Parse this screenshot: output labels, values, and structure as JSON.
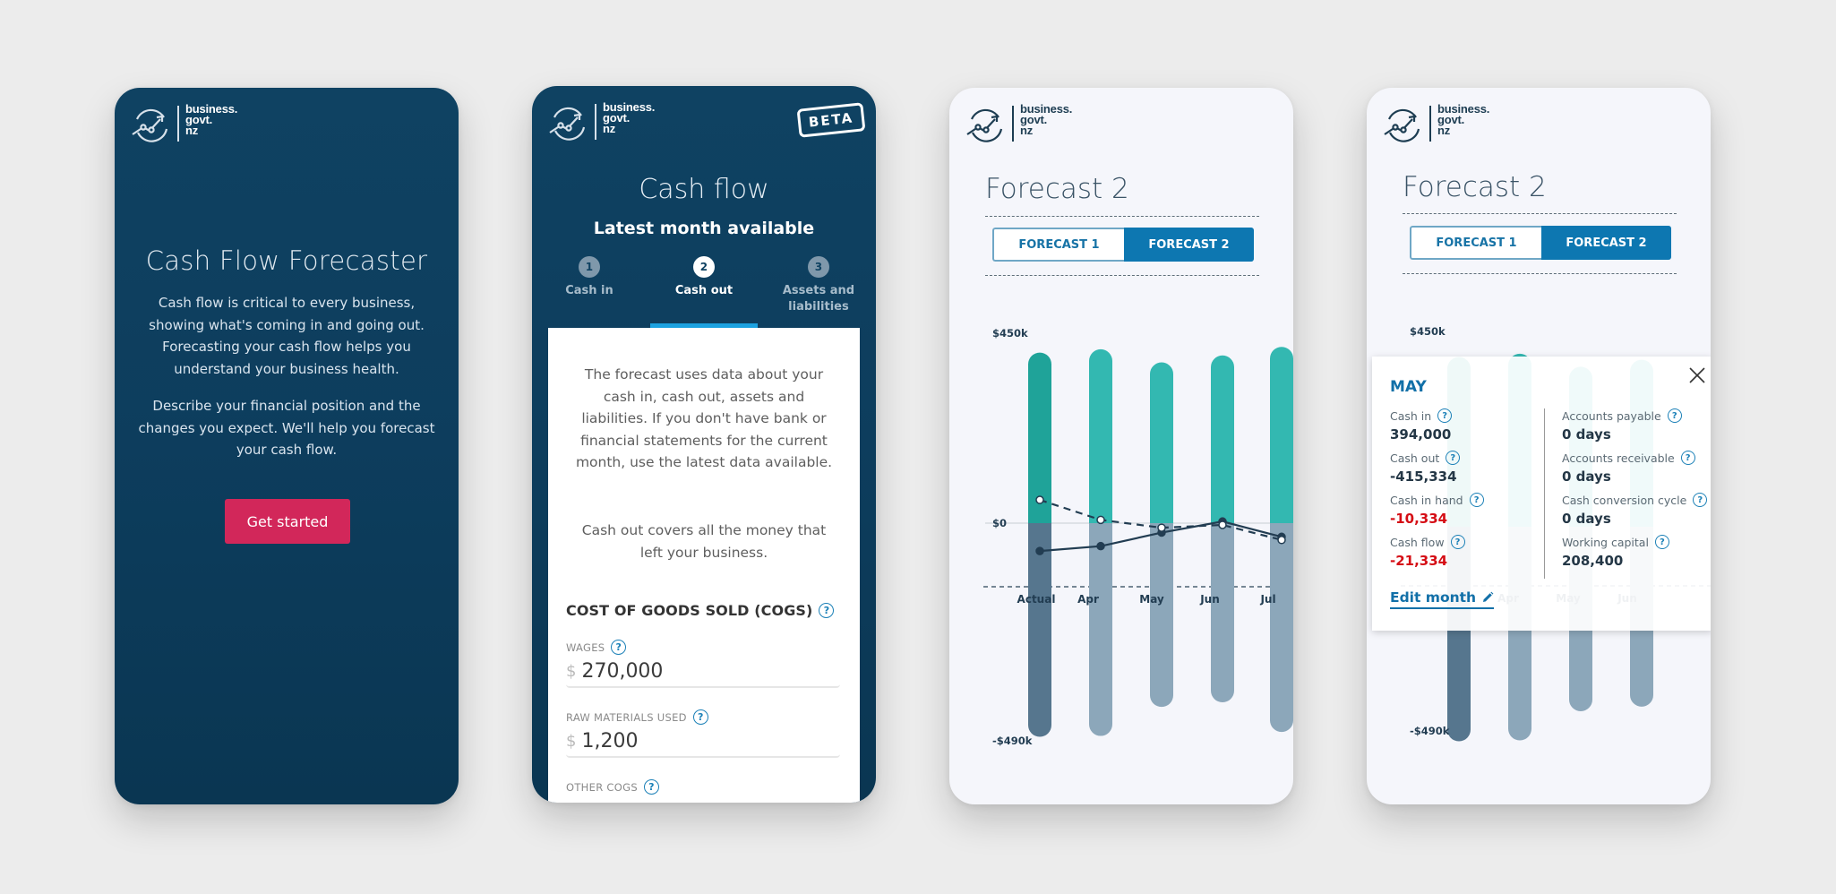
{
  "brand": {
    "line1": "business.",
    "line2": "govt.",
    "line3": "nz"
  },
  "colors": {
    "navy": "#0f4262",
    "cta": "#d2275a",
    "accent_blue": "#0d77b1",
    "step_underline": "#1ca2e0",
    "cash_in_actual": "#1fa399",
    "cash_in_forecast": "#33b8b1",
    "cash_out_actual": "#56768e",
    "cash_out_forecast": "#8ca7ba",
    "line": "#223d52",
    "negative": "#d50d15"
  },
  "screen1": {
    "title": "Cash Flow Forecaster",
    "paragraph1": "Cash flow is critical to every business, showing what's coming in and going out. Forecasting your cash flow helps you understand your business health.",
    "paragraph2": "Describe your financial position and the changes you expect. We'll help you forecast your cash flow.",
    "cta_label": "Get started"
  },
  "screen2": {
    "badge": "BETA",
    "title": "Cash flow",
    "subtitle": "Latest month available",
    "steps": [
      {
        "num": "1",
        "label": "Cash in",
        "state": "inactive"
      },
      {
        "num": "2",
        "label": "Cash out",
        "state": "active"
      },
      {
        "num": "3",
        "label": "Assets and liabilities",
        "state": "inactive"
      }
    ],
    "intro1": "The forecast uses data about your cash in, cash out, assets and liabilities. If you don't have bank or financial statements for the current month, use the latest data available.",
    "intro2": "Cash out covers all the money that left your business.",
    "section_title": "COST OF GOODS SOLD (COGS)",
    "help_glyph": "?",
    "currency_symbol": "$",
    "fields": [
      {
        "label": "WAGES",
        "value": "270,000"
      },
      {
        "label": "RAW MATERIALS USED",
        "value": "1,200"
      },
      {
        "label": "OTHER COGS",
        "value": ""
      }
    ]
  },
  "screen3": {
    "title": "Forecast 2",
    "toggle": {
      "option1": "FORECAST 1",
      "option2": "FORECAST 2",
      "selected": "FORECAST 2"
    }
  },
  "screen4": {
    "title": "Forecast 2",
    "toggle": {
      "option1": "FORECAST 1",
      "option2": "FORECAST 2",
      "selected": "FORECAST 2"
    },
    "popup": {
      "month": "MAY",
      "left": [
        {
          "label": "Cash in",
          "value": "394,000",
          "negative": false
        },
        {
          "label": "Cash out",
          "value": "-415,334",
          "negative": false
        },
        {
          "label": "Cash in hand",
          "value": "-10,334",
          "negative": true
        },
        {
          "label": "Cash flow",
          "value": "-21,334",
          "negative": true
        }
      ],
      "right": [
        {
          "label": "Accounts payable",
          "value": "0 days"
        },
        {
          "label": "Accounts receivable",
          "value": "0 days"
        },
        {
          "label": "Cash conversion cycle",
          "value": "0 days"
        },
        {
          "label": "Working capital",
          "value": "208,400"
        }
      ],
      "edit_label": "Edit month"
    }
  },
  "chart_data": [
    {
      "type": "bar",
      "title": "Forecast 2",
      "categories": [
        "Actual",
        "Apr",
        "May",
        "Jun",
        "Jul"
      ],
      "series": [
        {
          "name": "Cash in",
          "kind": "bar",
          "values": [
            418000,
            426000,
            394000,
            411000,
            432000
          ]
        },
        {
          "name": "Cash out",
          "kind": "bar",
          "values": [
            -483000,
            -481000,
            -415334,
            -405000,
            -472000
          ]
        },
        {
          "name": "Cash flow",
          "kind": "line-solid",
          "values": [
            -63000,
            -52000,
            -21334,
            4000,
            -31000
          ]
        },
        {
          "name": "Cash in hand",
          "kind": "line-dashed",
          "values": [
            57000,
            8000,
            -10334,
            -4000,
            -38000
          ]
        }
      ],
      "y_tick_labels": [
        "$450k",
        "$0",
        "-$490k"
      ],
      "ylim": [
        -490000,
        450000
      ],
      "xlabel": "",
      "ylabel": "",
      "grid": false
    },
    {
      "type": "bar",
      "title": "Forecast 2",
      "categories": [
        "Actual",
        "Apr",
        "May",
        "Jun"
      ],
      "series": [
        {
          "name": "Cash in",
          "kind": "bar",
          "values": [
            418000,
            426000,
            394000,
            411000
          ]
        },
        {
          "name": "Cash out",
          "kind": "bar",
          "values": [
            -483000,
            -481000,
            -415334,
            -405000
          ]
        }
      ],
      "y_tick_labels": [
        "$450k",
        "-$490k"
      ],
      "ylim": [
        -490000,
        450000
      ],
      "xlabel": "",
      "ylabel": "",
      "grid": false
    }
  ]
}
